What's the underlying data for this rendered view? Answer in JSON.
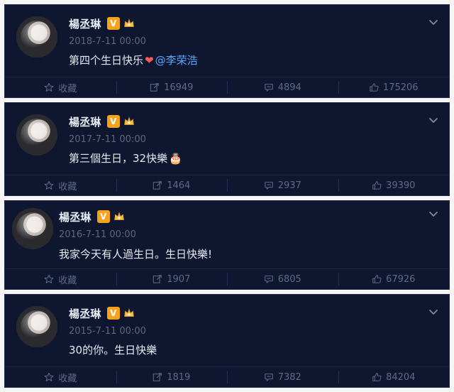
{
  "posts": [
    {
      "user": "楊丞琳",
      "badge": "V",
      "timestamp": "2018-7-11 00:00",
      "text": "第四个生日快乐",
      "emoji": "❤",
      "mention": "@李荣浩",
      "actions": {
        "favorite": "收藏",
        "repost": "16949",
        "comment": "4894",
        "like": "175206"
      }
    },
    {
      "user": "楊丞琳",
      "badge": "V",
      "timestamp": "2017-7-11 00:00",
      "text": "第三個生日，32快樂",
      "emoji": "🎂",
      "actions": {
        "favorite": "收藏",
        "repost": "1464",
        "comment": "2937",
        "like": "39390"
      }
    },
    {
      "user": "楊丞琳",
      "badge": "V",
      "timestamp": "2016-7-11 00:00",
      "text": "我家今天有人過生日。生日快樂!",
      "actions": {
        "favorite": "收藏",
        "repost": "1907",
        "comment": "6805",
        "like": "67926"
      }
    },
    {
      "user": "楊丞琳",
      "badge": "V",
      "timestamp": "2015-7-11 00:00",
      "text": "30的你。生日快樂",
      "actions": {
        "favorite": "收藏",
        "repost": "1819",
        "comment": "7382",
        "like": "84204"
      }
    }
  ],
  "colors": {
    "card_bg": "#0f1730",
    "text": "#e6e9f1",
    "muted": "#5c6a87",
    "mention": "#56a7ff",
    "v_badge": "#f6a21b"
  },
  "icons": [
    "avatar",
    "v-badge",
    "crown-icon",
    "chevron-down-icon",
    "star-icon",
    "repost-icon",
    "comment-icon",
    "like-icon"
  ]
}
